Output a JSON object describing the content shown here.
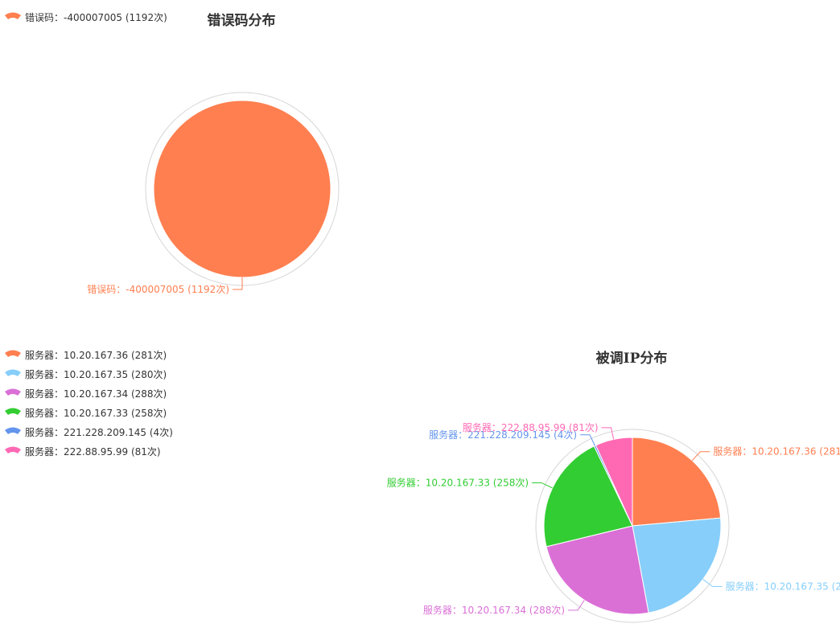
{
  "chart_data": [
    {
      "type": "pie",
      "title": "错误码分布",
      "legend_position": "top-left",
      "slices": [
        {
          "label": "错误码：-400007005 (1192次)",
          "value": 1192,
          "color": "#FF7F50"
        }
      ]
    },
    {
      "type": "pie",
      "title": "被调IP分布",
      "legend_position": "left",
      "slices": [
        {
          "label": "服务器：10.20.167.36 (281次)",
          "value": 281,
          "color": "#FF7F50"
        },
        {
          "label": "服务器：10.20.167.35 (280次)",
          "value": 280,
          "color": "#87CEFA"
        },
        {
          "label": "服务器：10.20.167.34 (288次)",
          "value": 288,
          "color": "#DA70D6"
        },
        {
          "label": "服务器：10.20.167.33 (258次)",
          "value": 258,
          "color": "#32CD32"
        },
        {
          "label": "服务器：221.228.209.145 (4次)",
          "value": 4,
          "color": "#6495ED"
        },
        {
          "label": "服务器：222.88.95.99 (81次)",
          "value": 81,
          "color": "#FF69B4"
        }
      ]
    }
  ]
}
